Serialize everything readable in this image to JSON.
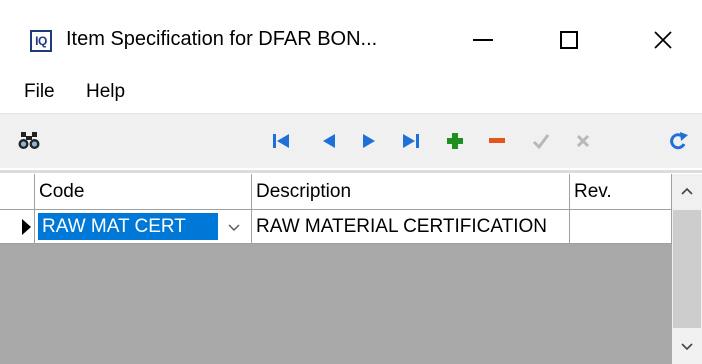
{
  "window": {
    "app_icon_text": "IQ",
    "title": "Item Specification for DFAR BON...",
    "minimize_icon": "minimize-icon",
    "maximize_icon": "maximize-icon",
    "close_icon": "close-icon"
  },
  "menu": {
    "items": [
      {
        "label": "File"
      },
      {
        "label": "Help"
      }
    ]
  },
  "toolbar": {
    "buttons": [
      {
        "name": "find",
        "icon": "binoculars-icon"
      },
      {
        "name": "first",
        "icon": "first-record-icon"
      },
      {
        "name": "prior",
        "icon": "prior-record-icon"
      },
      {
        "name": "next",
        "icon": "next-record-icon"
      },
      {
        "name": "last",
        "icon": "last-record-icon"
      },
      {
        "name": "insert",
        "icon": "plus-icon"
      },
      {
        "name": "delete",
        "icon": "minus-icon"
      },
      {
        "name": "post",
        "icon": "check-icon"
      },
      {
        "name": "cancel",
        "icon": "x-icon"
      },
      {
        "name": "refresh",
        "icon": "refresh-icon"
      }
    ],
    "colors": {
      "nav": "#1e6fd9",
      "insert": "#1f8f1f",
      "delete": "#e5561f",
      "disabled": "#b8b8b8"
    }
  },
  "grid": {
    "columns": [
      {
        "label": "Code"
      },
      {
        "label": "Description"
      },
      {
        "label": "Rev."
      }
    ],
    "rows": [
      {
        "code": "RAW MAT CERT",
        "description": "RAW MATERIAL CERTIFICATION",
        "rev": ""
      }
    ],
    "selection_color": "#0078d7"
  }
}
